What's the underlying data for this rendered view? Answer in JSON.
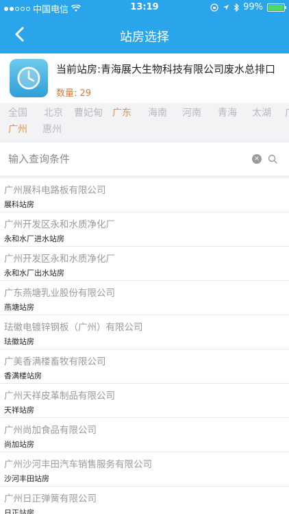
{
  "status_bar": {
    "carrier": "中国电信",
    "time": "13:19",
    "battery_pct": "99%",
    "battery_level": 0.99
  },
  "nav": {
    "title": "站房选择"
  },
  "current_station": {
    "label": "当前站房:青海展大生物科技有限公司废水总排口",
    "count_label": "数量: 29"
  },
  "regions": {
    "row1": [
      "全国",
      "北京",
      "曹妃甸",
      "广东",
      "海南",
      "河南",
      "青海",
      "太湖",
      "广"
    ],
    "row2": [
      "广州",
      "惠州"
    ],
    "active": "广东",
    "active_sub": "广州"
  },
  "search": {
    "placeholder": "输入查询条件"
  },
  "stations": [
    {
      "company": "广州展科电路板有限公司",
      "station": "展科站房"
    },
    {
      "company": "广州开发区永和水质净化厂",
      "station": "永和水厂进水站房"
    },
    {
      "company": "广州开发区永和水质净化厂",
      "station": "永和水厂出水站房"
    },
    {
      "company": "广东燕塘乳业股份有限公司",
      "station": "燕塘站房"
    },
    {
      "company": "珐徽电镀锌钢板（广州）有限公司",
      "station": "珐徽站房"
    },
    {
      "company": "广美香满楼畜牧有限公司",
      "station": "香满楼站房"
    },
    {
      "company": "广州天祥皮革制品有限公司",
      "station": "天祥站房"
    },
    {
      "company": "广州尚加食品有限公司",
      "station": "尚加站房"
    },
    {
      "company": "广州沙河丰田汽车销售服务有限公司",
      "station": "沙河丰田站房"
    },
    {
      "company": "广州日正弹簧有限公司",
      "station": "日正站房"
    }
  ],
  "colors": {
    "brand": "#2aa5ec",
    "active": "#e8913d",
    "count": "#d67a3a"
  }
}
